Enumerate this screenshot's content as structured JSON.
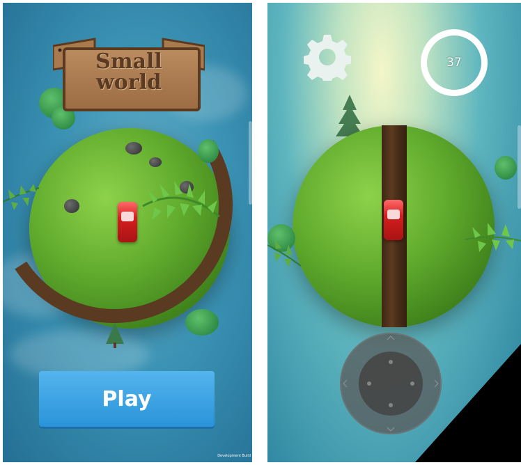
{
  "left_screen": {
    "title_sign": {
      "line1": "Small",
      "line2": "world"
    },
    "play_button": {
      "label": "Play"
    },
    "dev_build": "Development Build"
  },
  "right_screen": {
    "settings_icon": "gear-icon",
    "timer": {
      "value": "37"
    },
    "joystick_icon": "joystick-icon"
  },
  "colors": {
    "play_button": "#2a93d9",
    "planet_green": "#5ea92c",
    "road_brown": "#5a3b22",
    "car_red": "#d41e1e"
  }
}
